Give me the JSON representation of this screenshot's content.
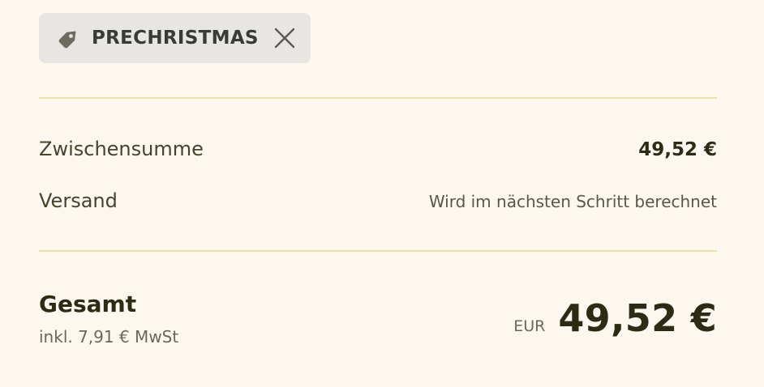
{
  "discount": {
    "code": "PRECHRISTMAS",
    "tag_icon": "tag-icon",
    "remove_icon": "close-icon"
  },
  "summary": {
    "subtotal_label": "Zwischensumme",
    "subtotal_value": "49,52 €",
    "shipping_label": "Versand",
    "shipping_value": "Wird im nächsten Schritt berechnet"
  },
  "total": {
    "label": "Gesamt",
    "tax_note": "inkl. 7,91 € MwSt",
    "currency": "EUR",
    "amount": "49,52 €"
  },
  "colors": {
    "background": "#fcf8ef",
    "divider": "#ece0a8",
    "tag_background": "#e8e6e2",
    "text_dark": "#2e2a14"
  }
}
